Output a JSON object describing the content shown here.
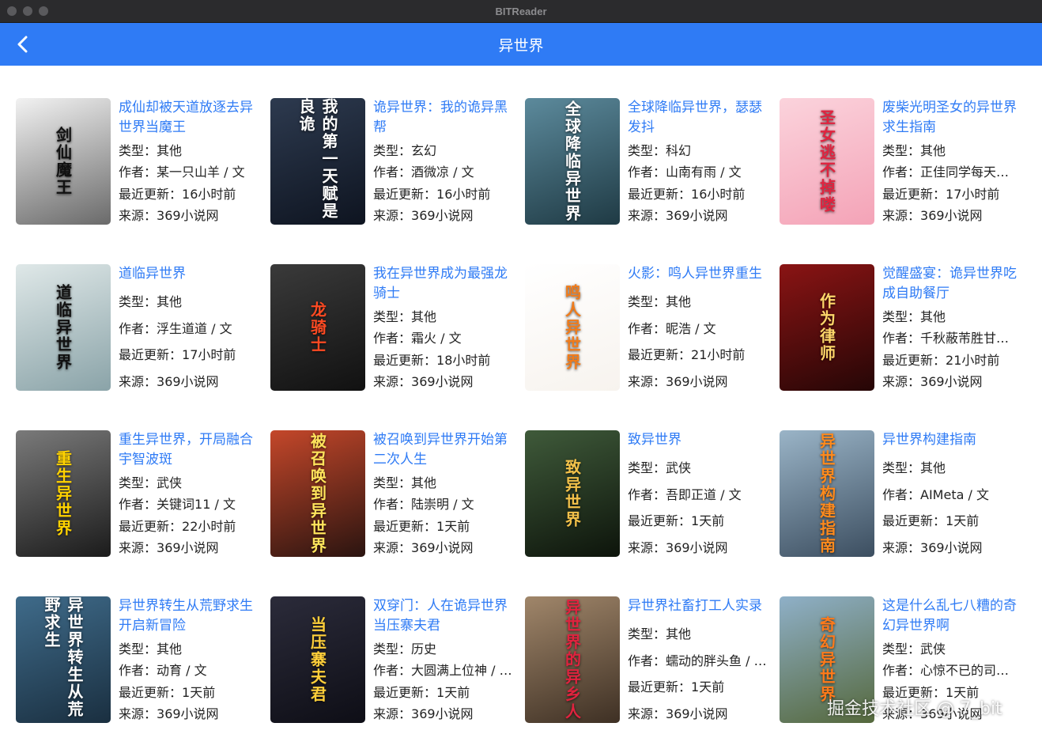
{
  "window": {
    "title": "BITReader"
  },
  "appbar": {
    "title": "异世界"
  },
  "labels": {
    "type": "类型：",
    "author": "作者：",
    "updated": "最近更新：",
    "source": "来源："
  },
  "books": [
    {
      "title": "成仙却被天道放逐去异世界当魔王",
      "type": "其他",
      "author": "某一只山羊 / 文",
      "updated": "16小时前",
      "source": "369小说网",
      "cover_text": "剑仙魔王",
      "cover_bg": [
        "#f2f2f2",
        "#6a6a6a"
      ],
      "cover_fg": "#111111"
    },
    {
      "title": "诡异世界：我的诡异黑帮",
      "type": "玄幻",
      "author": "酒微凉 / 文",
      "updated": "16小时前",
      "source": "369小说网",
      "cover_text": "我的第一天赋是良诡",
      "cover_bg": [
        "#2d3a4f",
        "#0e1420"
      ],
      "cover_fg": "#ffffff"
    },
    {
      "title": "全球降临异世界，瑟瑟发抖",
      "type": "科幻",
      "author": "山南有雨 / 文",
      "updated": "16小时前",
      "source": "369小说网",
      "cover_text": "全球降临异世界",
      "cover_bg": [
        "#5c8a9c",
        "#1f3a44"
      ],
      "cover_fg": "#ffffff"
    },
    {
      "title": "废柴光明圣女的异世界求生指南",
      "type": "其他",
      "author": "正佳同学每天…",
      "updated": "17小时前",
      "source": "369小说网",
      "cover_text": "圣女逃不掉喽",
      "cover_bg": [
        "#fbd3dc",
        "#f4a3b7"
      ],
      "cover_fg": "#e0233f"
    },
    {
      "title": "道临异世界",
      "type": "其他",
      "author": "浮生道道 / 文",
      "updated": "17小时前",
      "source": "369小说网",
      "cover_text": "道临异世界",
      "cover_bg": [
        "#dfe8e8",
        "#8aa3a8"
      ],
      "cover_fg": "#111111"
    },
    {
      "title": "我在异世界成为最强龙骑士",
      "type": "其他",
      "author": "霜火 / 文",
      "updated": "18小时前",
      "source": "369小说网",
      "cover_text": "龙骑士",
      "cover_bg": [
        "#3a3a3a",
        "#111111"
      ],
      "cover_fg": "#ff4a22"
    },
    {
      "title": "火影：鸣人异世界重生",
      "type": "其他",
      "author": "昵浩 / 文",
      "updated": "21小时前",
      "source": "369小说网",
      "cover_text": "鸣人异世界",
      "cover_bg": [
        "#ffffff",
        "#f7f3ee"
      ],
      "cover_fg": "#f07b1a"
    },
    {
      "title": "觉醒盛宴：诡异世界吃成自助餐厅",
      "type": "其他",
      "author": "千秋蔽芾胜甘…",
      "updated": "21小时前",
      "source": "369小说网",
      "cover_text": "作为律师",
      "cover_bg": [
        "#8a1414",
        "#250606"
      ],
      "cover_fg": "#ffd76a"
    },
    {
      "title": "重生异世界，开局融合宇智波斑",
      "type": "武侠",
      "author": "关键词11 / 文",
      "updated": "22小时前",
      "source": "369小说网",
      "cover_text": "重生异世界",
      "cover_bg": [
        "#7a7a7a",
        "#1b1b1b"
      ],
      "cover_fg": "#ffd200"
    },
    {
      "title": "被召唤到异世界开始第二次人生",
      "type": "其他",
      "author": "陆崇明 / 文",
      "updated": "1天前",
      "source": "369小说网",
      "cover_text": "被召唤到异世界",
      "cover_bg": [
        "#c4472a",
        "#2a1410"
      ],
      "cover_fg": "#ffe45c"
    },
    {
      "title": "致异世界",
      "type": "武侠",
      "author": "吾即正道 / 文",
      "updated": "1天前",
      "source": "369小说网",
      "cover_text": "致异世界",
      "cover_bg": [
        "#3f5a3a",
        "#0d140b"
      ],
      "cover_fg": "#f2c14a"
    },
    {
      "title": "异世界构建指南",
      "type": "其他",
      "author": "AIMeta / 文",
      "updated": "1天前",
      "source": "369小说网",
      "cover_text": "异世界构建指南",
      "cover_bg": [
        "#9ab4c7",
        "#3c4e60"
      ],
      "cover_fg": "#ff8a1c"
    },
    {
      "title": "异世界转生从荒野求生开启新冒险",
      "type": "其他",
      "author": "动育 / 文",
      "updated": "1天前",
      "source": "369小说网",
      "cover_text": "异世界转生从荒野求生",
      "cover_bg": [
        "#3f6b8a",
        "#1a2f40"
      ],
      "cover_fg": "#ffffff"
    },
    {
      "title": "双穿门：人在诡异世界当压寨夫君",
      "type": "历史",
      "author": "大圆满上位神 / …",
      "updated": "1天前",
      "source": "369小说网",
      "cover_text": "当压寨夫君",
      "cover_bg": [
        "#2b2b3a",
        "#0e0e16"
      ],
      "cover_fg": "#ffcf3a"
    },
    {
      "title": "异世界社畜打工人实录",
      "type": "其他",
      "author": "蠕动的胖头鱼 / …",
      "updated": "1天前",
      "source": "369小说网",
      "cover_text": "异世界的异乡人",
      "cover_bg": [
        "#a0866a",
        "#3e3024"
      ],
      "cover_fg": "#e0233f"
    },
    {
      "title": "这是什么乱七八糟的奇幻异世界啊",
      "type": "武侠",
      "author": "心惊不已的司…",
      "updated": "1天前",
      "source": "369小说网",
      "cover_text": "奇幻异世界",
      "cover_bg": [
        "#8fb0c8",
        "#55683c"
      ],
      "cover_fg": "#ff7a1a"
    }
  ],
  "watermark": "掘金技术社区 @ 7_bit"
}
